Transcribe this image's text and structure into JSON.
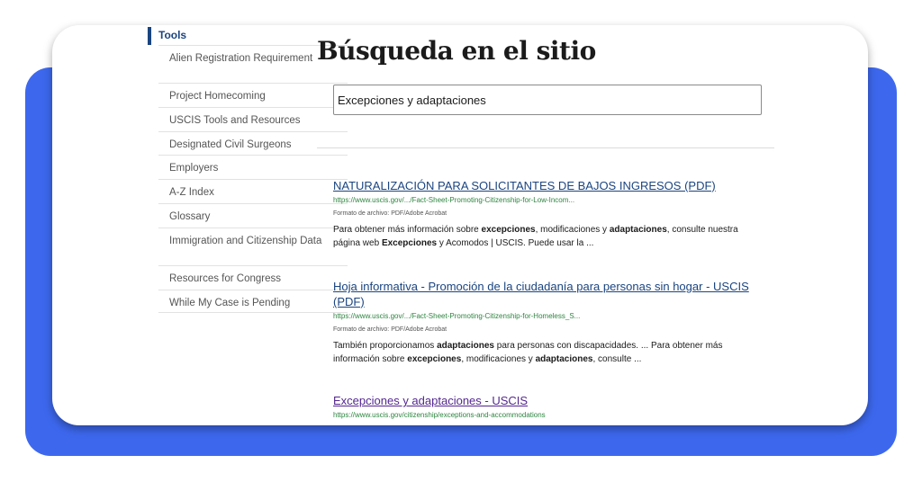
{
  "sidebar": {
    "section_title": "Tools",
    "items": [
      {
        "label": "Alien Registration Requirement"
      },
      {
        "label": "Project Homecoming"
      },
      {
        "label": "USCIS Tools and Resources"
      },
      {
        "label": "Designated Civil Surgeons"
      },
      {
        "label": "Employers"
      },
      {
        "label": "A-Z Index"
      },
      {
        "label": "Glossary"
      },
      {
        "label": "Immigration and Citizenship Data"
      },
      {
        "label": "Resources for Congress"
      },
      {
        "label": "While My Case is Pending"
      }
    ]
  },
  "main": {
    "title": "Búsqueda en el sitio",
    "search_value": "Excepciones y adaptaciones",
    "results": [
      {
        "title": "NATURALIZACIÓN PARA SOLICITANTES DE BAJOS INGRESOS (PDF)",
        "url": "https://www.uscis.gov/.../Fact-Sheet-Promoting-Citizenship-for-Low-Incom...",
        "format": "Formato de archivo: PDF/Adobe Acrobat",
        "snippet": [
          {
            "t": "Para obtener más información sobre ",
            "b": false
          },
          {
            "t": "excepciones",
            "b": true
          },
          {
            "t": ", modificaciones y ",
            "b": false
          },
          {
            "t": "adaptaciones",
            "b": true
          },
          {
            "t": ", consulte nuestra página web ",
            "b": false
          },
          {
            "t": "Excepciones",
            "b": true
          },
          {
            "t": " y Acomodos | USCIS. Puede usar la ...",
            "b": false
          }
        ]
      },
      {
        "title": "Hoja informativa - Promoción de la ciudadanía para personas sin hogar - USCIS (PDF)",
        "url": "https://www.uscis.gov/.../Fact-Sheet-Promoting-Citizenship-for-Homeless_S...",
        "format": "Formato de archivo: PDF/Adobe Acrobat",
        "snippet": [
          {
            "t": "También proporcionamos ",
            "b": false
          },
          {
            "t": "adaptaciones",
            "b": true
          },
          {
            "t": " para personas con discapacidades. ... Para obtener más información sobre ",
            "b": false
          },
          {
            "t": "excepciones",
            "b": true
          },
          {
            "t": ", modificaciones y ",
            "b": false
          },
          {
            "t": "adaptaciones",
            "b": true
          },
          {
            "t": ", consulte ...",
            "b": false
          }
        ]
      },
      {
        "title": "Excepciones y adaptaciones - USCIS",
        "url": "https://www.uscis.gov/citizenship/exceptions-and-accommodations",
        "visited": true
      }
    ]
  },
  "colors": {
    "backdrop": "#3d68ee",
    "link": "#1a4480",
    "visited_link": "#54278f",
    "url_green": "#2e8540"
  }
}
